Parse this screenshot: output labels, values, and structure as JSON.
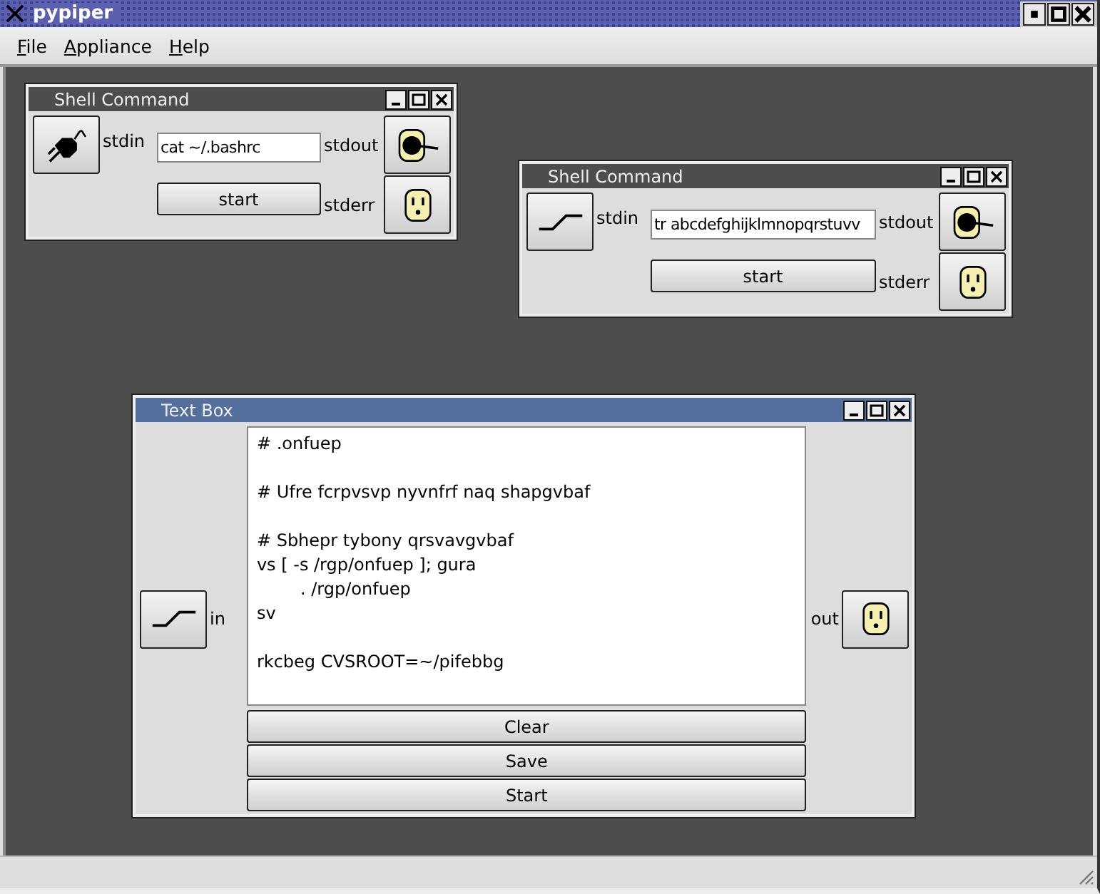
{
  "app": {
    "title": "pypiper"
  },
  "menu": [
    {
      "label": "File"
    },
    {
      "label": "Appliance"
    },
    {
      "label": "Help"
    }
  ],
  "windows": [
    {
      "kind": "shell",
      "title": "Shell Command",
      "active": false,
      "input": {
        "label": "stdin",
        "connected": false
      },
      "command": "cat ~/.bashrc",
      "button": "start",
      "outputs": [
        {
          "label": "stdout",
          "connected": true
        },
        {
          "label": "stderr",
          "connected": false
        }
      ]
    },
    {
      "kind": "shell",
      "title": "Shell Command",
      "active": false,
      "input": {
        "label": "stdin",
        "connected": true
      },
      "command": "tr abcdefghijklmnopqrstuvv",
      "button": "start",
      "outputs": [
        {
          "label": "stdout",
          "connected": true
        },
        {
          "label": "stderr",
          "connected": false
        }
      ]
    },
    {
      "kind": "textbox",
      "title": "Text Box",
      "active": true,
      "input": {
        "label": "in",
        "connected": true
      },
      "text": "# .onfuep\n\n# Ufre fcrpvsvp nyvnfrf naq shapgvbaf\n\n# Sbhepr tybony qrsvavgvbaf\nvs [ -s /rgp/onfuep ]; gura\n\t. /rgp/onfuep\nsv\n\nrkcbeg CVSROOT=~/pifebbg",
      "buttons": [
        "Clear",
        "Save",
        "Start"
      ],
      "outputs": [
        {
          "label": "out",
          "connected": false
        }
      ]
    }
  ]
}
